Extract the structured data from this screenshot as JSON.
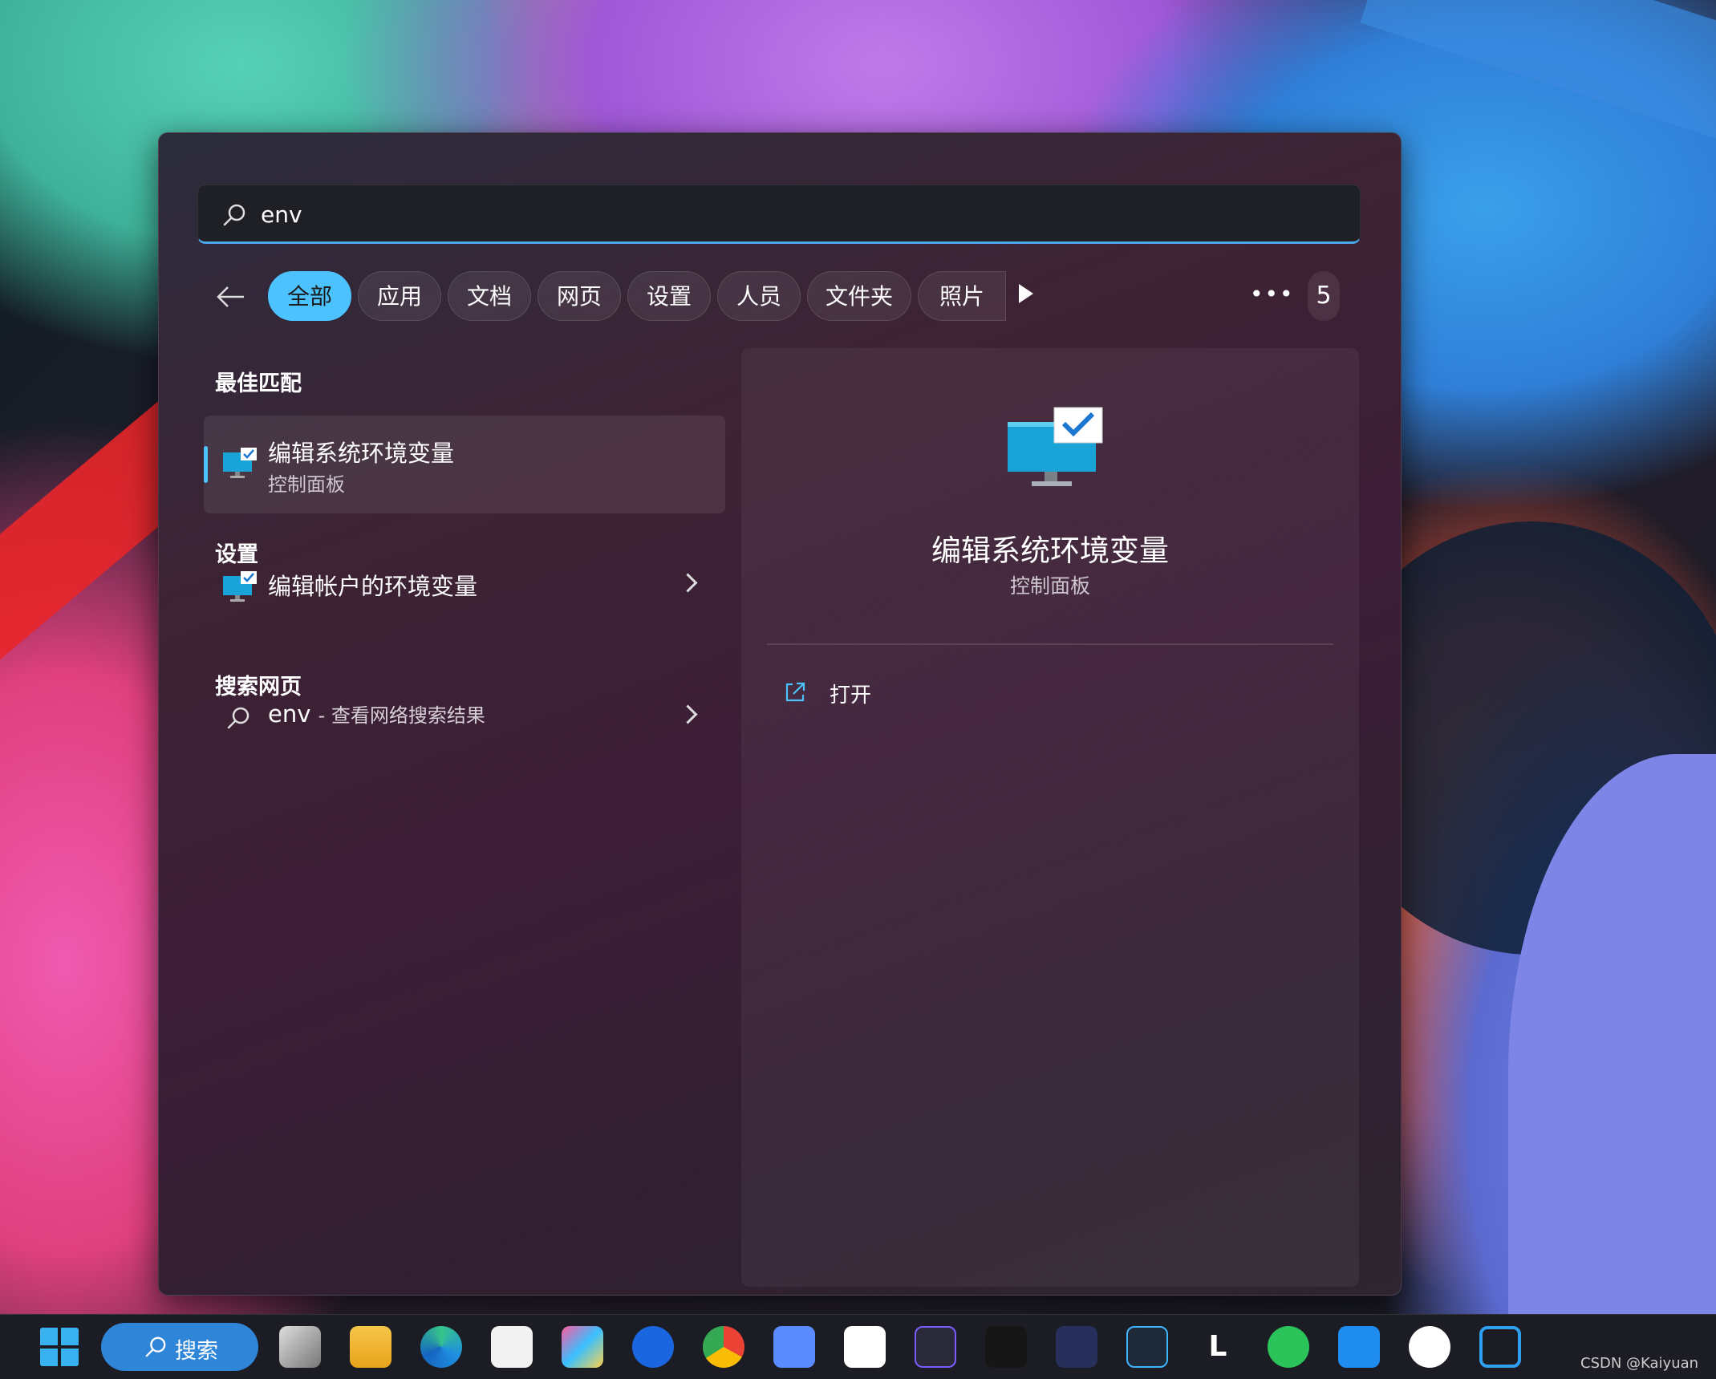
{
  "search": {
    "query": "env"
  },
  "filters": {
    "tabs": [
      "全部",
      "应用",
      "文档",
      "网页",
      "设置",
      "人员",
      "文件夹",
      "照片"
    ],
    "active_index": 0,
    "result_count": "5"
  },
  "sections": {
    "best_match": "最佳匹配",
    "settings": "设置",
    "web": "搜索网页"
  },
  "best_match": {
    "title": "编辑系统环境变量",
    "subtitle": "控制面板"
  },
  "settings_items": [
    {
      "label": "编辑帐户的环境变量"
    }
  ],
  "web_item": {
    "query": "env",
    "suffix": "- 查看网络搜索结果"
  },
  "preview": {
    "title": "编辑系统环境变量",
    "subtitle": "控制面板",
    "action": "打开"
  },
  "taskbar": {
    "search_label": "搜索",
    "watermark": "CSDN @Kaiyuan",
    "apps": [
      "start-icon",
      "task-view-icon",
      "file-explorer-icon",
      "edge-icon",
      "store-icon",
      "arc-icon",
      "maps-pin-icon",
      "chrome-icon",
      "pen-icon",
      "cloud-icon",
      "nox-icon",
      "tiktok-icon",
      "cat-icon",
      "nox2-icon",
      "l-icon",
      "wechat-icon",
      "feishu-icon",
      "ring-icon",
      "vscode-icon"
    ]
  },
  "colors": {
    "accent": "#4cc2ff",
    "panel": "#3b1d36",
    "taskbar": "#1c1d24"
  }
}
